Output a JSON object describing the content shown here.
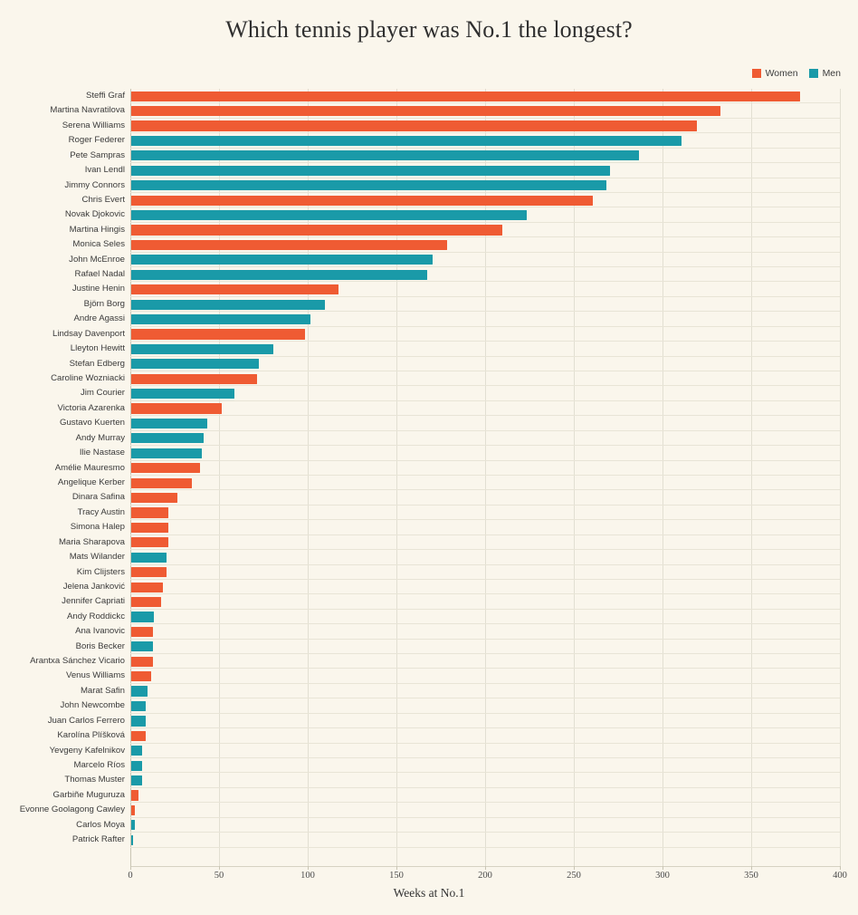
{
  "chart_data": {
    "type": "bar",
    "orientation": "horizontal",
    "title": "Which tennis player was No.1 the longest?",
    "xlabel": "Weeks at No.1",
    "ylabel": "",
    "xlim": [
      0,
      400
    ],
    "xticks": [
      0,
      50,
      100,
      150,
      200,
      250,
      300,
      350,
      400
    ],
    "grid": true,
    "legend_position": "top-right",
    "colors": {
      "Women": "#ef5b33",
      "Men": "#1a9aa8",
      "background": "#faf6ec",
      "gridline": "#e2dfd2",
      "text": "#3a3a3a"
    },
    "legend": [
      {
        "label": "Women",
        "color": "#ef5b33"
      },
      {
        "label": "Men",
        "color": "#1a9aa8"
      }
    ],
    "categories": [
      "Steffi Graf",
      "Martina Navratilova",
      "Serena Williams",
      "Roger Federer",
      "Pete Sampras",
      "Ivan Lendl",
      "Jimmy Connors",
      "Chris Evert",
      "Novak Djokovic",
      "Martina Hingis",
      "Monica Seles",
      "John McEnroe",
      "Rafael Nadal",
      "Justine Henin",
      "Björn Borg",
      "Andre Agassi",
      "Lindsay Davenport",
      "Lleyton Hewitt",
      "Stefan Edberg",
      "Caroline Wozniacki",
      "Jim Courier",
      "Victoria Azarenka",
      "Gustavo Kuerten",
      "Andy Murray",
      "Ilie Nastase",
      "Amélie Mauresmo",
      "Angelique Kerber",
      "Dinara Safina",
      "Tracy Austin",
      "Simona Halep",
      "Maria Sharapova",
      "Mats Wilander",
      "Kim Clijsters",
      "Jelena Janković",
      "Jennifer Capriati",
      "Andy Roddickc",
      "Ana Ivanovic",
      "Boris Becker",
      "Arantxa Sánchez Vicario",
      "Venus Williams",
      "Marat Safin",
      "John Newcombe",
      "Juan Carlos Ferrero",
      "Karolína Plíšková",
      "Yevgeny Kafelnikov",
      "Marcelo Ríos",
      "Thomas Muster",
      "Garbiñe Muguruza",
      "Evonne Goolagong Cawley",
      "Carlos Moya",
      "Patrick Rafter"
    ],
    "values": [
      377,
      332,
      319,
      310,
      286,
      270,
      268,
      260,
      223,
      209,
      178,
      170,
      167,
      117,
      109,
      101,
      98,
      80,
      72,
      71,
      58,
      51,
      43,
      41,
      40,
      39,
      34,
      26,
      21,
      21,
      21,
      20,
      20,
      18,
      17,
      13,
      12,
      12,
      12,
      11,
      9,
      8,
      8,
      8,
      6,
      6,
      6,
      4,
      2,
      2,
      1
    ],
    "groups": [
      "Women",
      "Women",
      "Women",
      "Men",
      "Men",
      "Men",
      "Men",
      "Women",
      "Men",
      "Women",
      "Women",
      "Men",
      "Men",
      "Women",
      "Men",
      "Men",
      "Women",
      "Men",
      "Men",
      "Women",
      "Men",
      "Women",
      "Men",
      "Men",
      "Men",
      "Women",
      "Women",
      "Women",
      "Women",
      "Women",
      "Women",
      "Men",
      "Women",
      "Women",
      "Women",
      "Men",
      "Women",
      "Men",
      "Women",
      "Women",
      "Men",
      "Men",
      "Men",
      "Women",
      "Men",
      "Men",
      "Men",
      "Women",
      "Women",
      "Men",
      "Men"
    ]
  }
}
